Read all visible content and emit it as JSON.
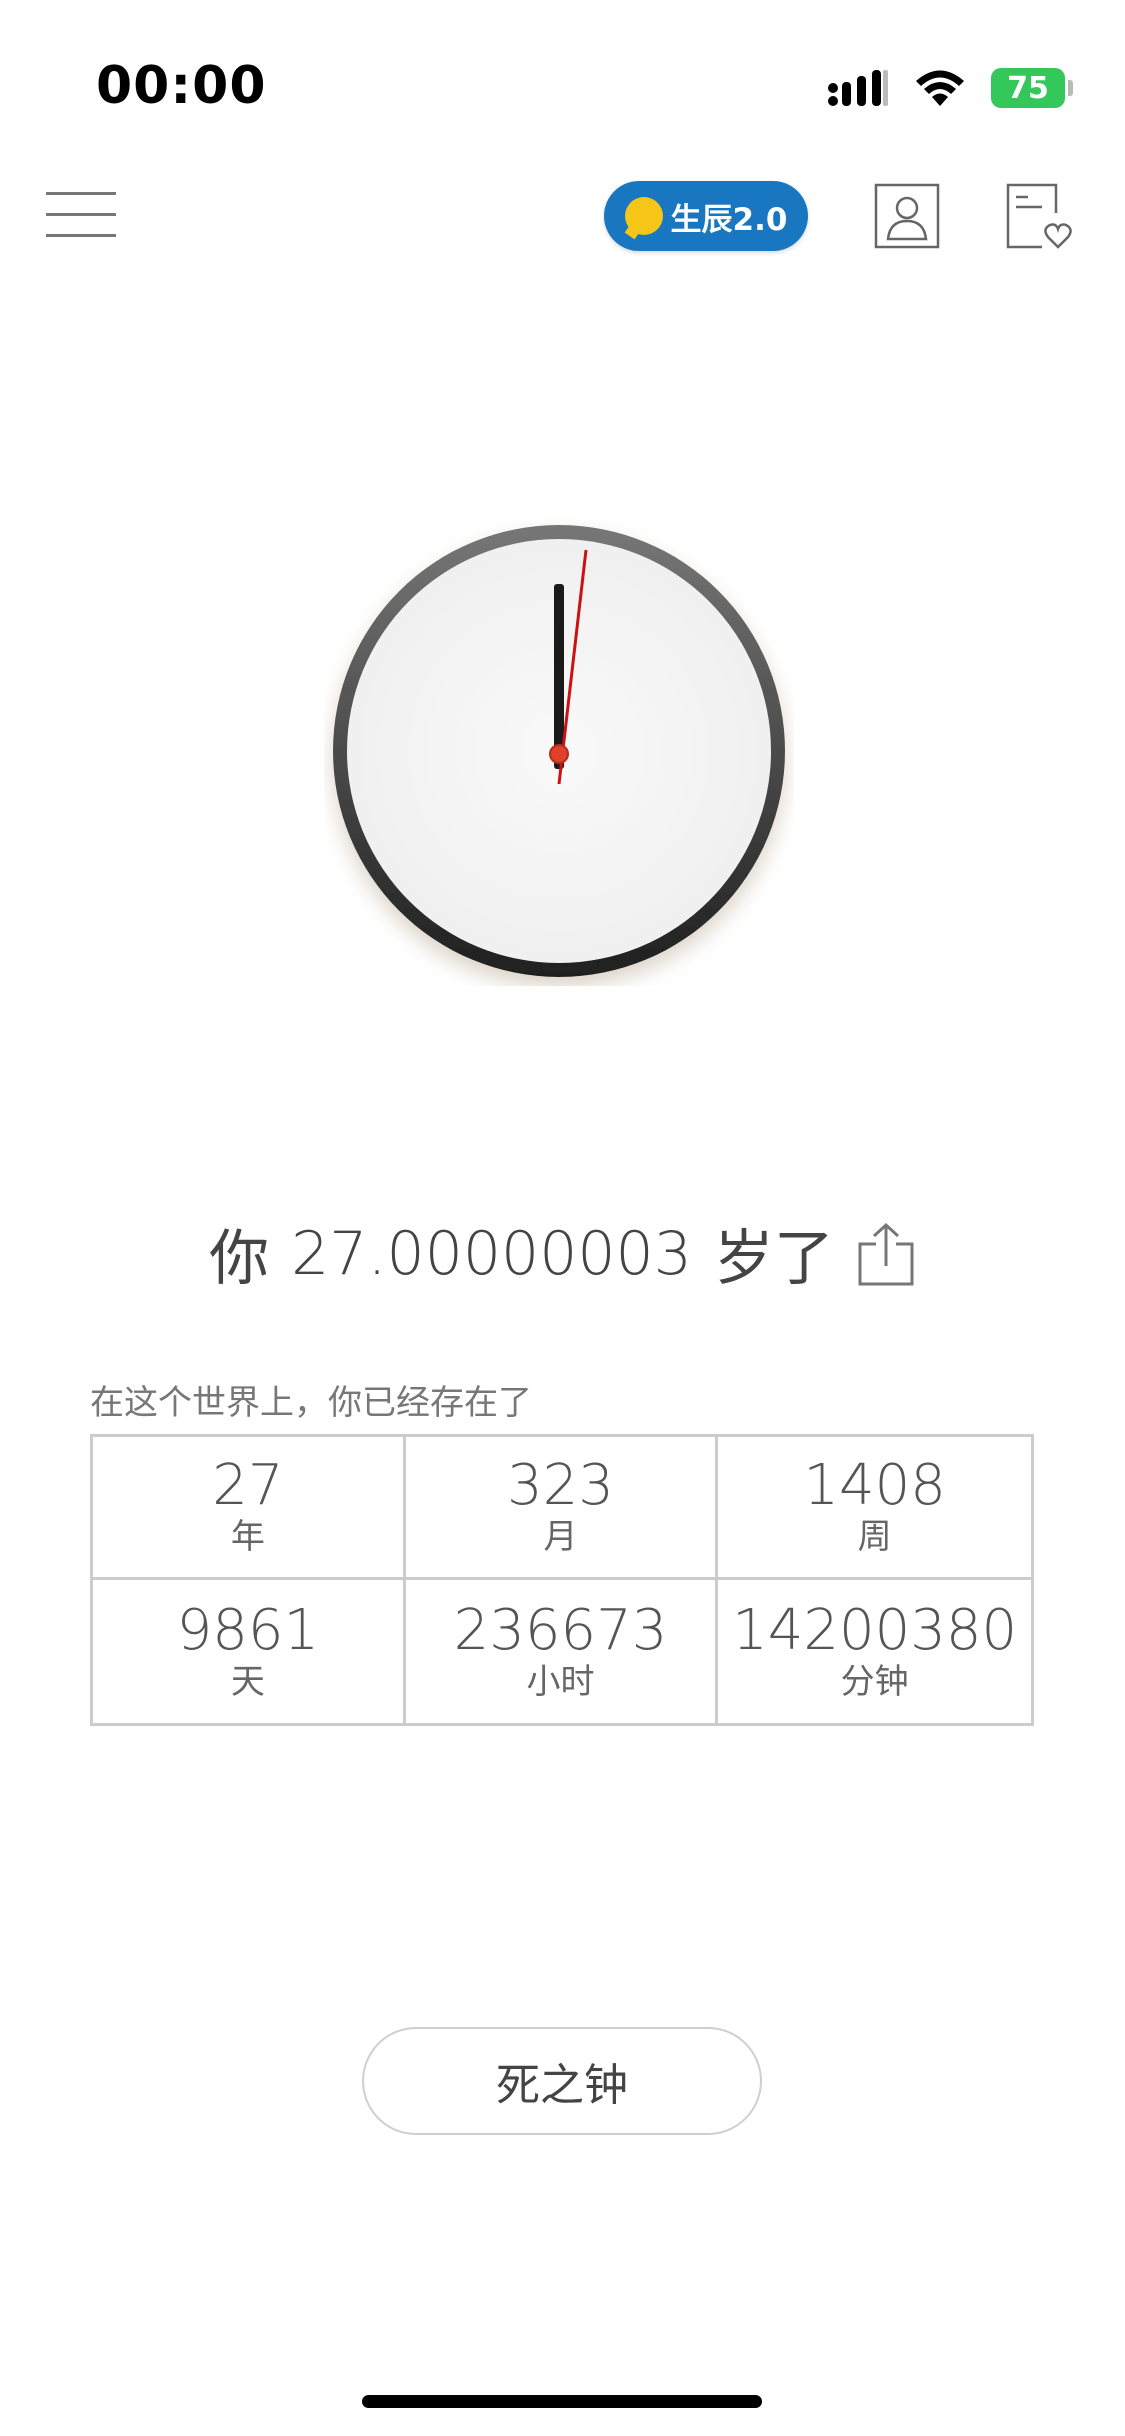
{
  "status_bar": {
    "time": "00:00",
    "battery": "75"
  },
  "header": {
    "badge_label": "生辰2.0"
  },
  "age": {
    "prefix": "你",
    "value": "27.00000003",
    "suffix": "岁了"
  },
  "intro": "在这个世界上，你已经存在了",
  "stats": [
    {
      "value": "27",
      "unit": "年"
    },
    {
      "value": "323",
      "unit": "月"
    },
    {
      "value": "1408",
      "unit": "周"
    },
    {
      "value": "9861",
      "unit": "天"
    },
    {
      "value": "236673",
      "unit": "小时"
    },
    {
      "value": "14200380",
      "unit": "分钟"
    }
  ],
  "death_clock_label": "死之钟",
  "colors": {
    "badge": "#1977c2",
    "battery": "#34c759",
    "second_hand": "#cc1111"
  }
}
